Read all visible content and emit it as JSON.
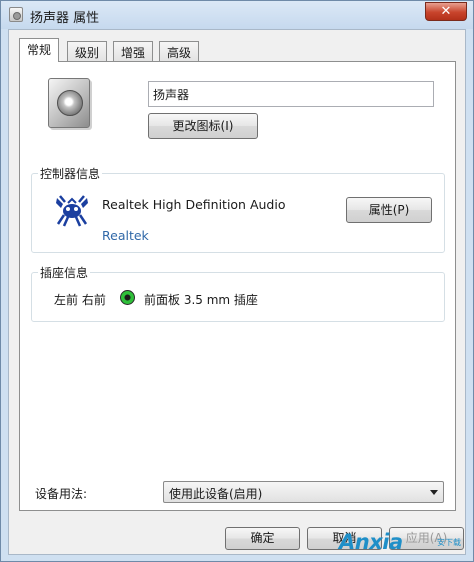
{
  "window": {
    "title": "扬声器 属性",
    "close_glyph": "✕"
  },
  "tabs": [
    {
      "label": "常规",
      "active": true
    },
    {
      "label": "级别",
      "active": false
    },
    {
      "label": "增强",
      "active": false
    },
    {
      "label": "高级",
      "active": false
    }
  ],
  "general": {
    "device_name_value": "扬声器",
    "change_icon_label": "更改图标(I)"
  },
  "controller": {
    "group_title": "控制器信息",
    "device": "Realtek High Definition Audio",
    "vendor": "Realtek",
    "properties_label": "属性(P)"
  },
  "jack": {
    "group_title": "插座信息",
    "channels": "左前 右前",
    "location": "前面板 3.5 mm 插座",
    "color": "#2fbf3a"
  },
  "usage": {
    "label": "设备用法:",
    "selected": "使用此设备(启用)"
  },
  "buttons": {
    "ok": "确定",
    "cancel": "取消",
    "apply": "应用(A)"
  },
  "watermark": {
    "logo": "Anxia",
    "sub": "安下载"
  },
  "icons": {
    "window_icon": "speaker-icon",
    "device_icon": "speaker-icon",
    "controller_icon": "realtek-crab-icon",
    "jack_icon": "green-jack-icon",
    "dropdown_icon": "chevron-down-icon"
  }
}
